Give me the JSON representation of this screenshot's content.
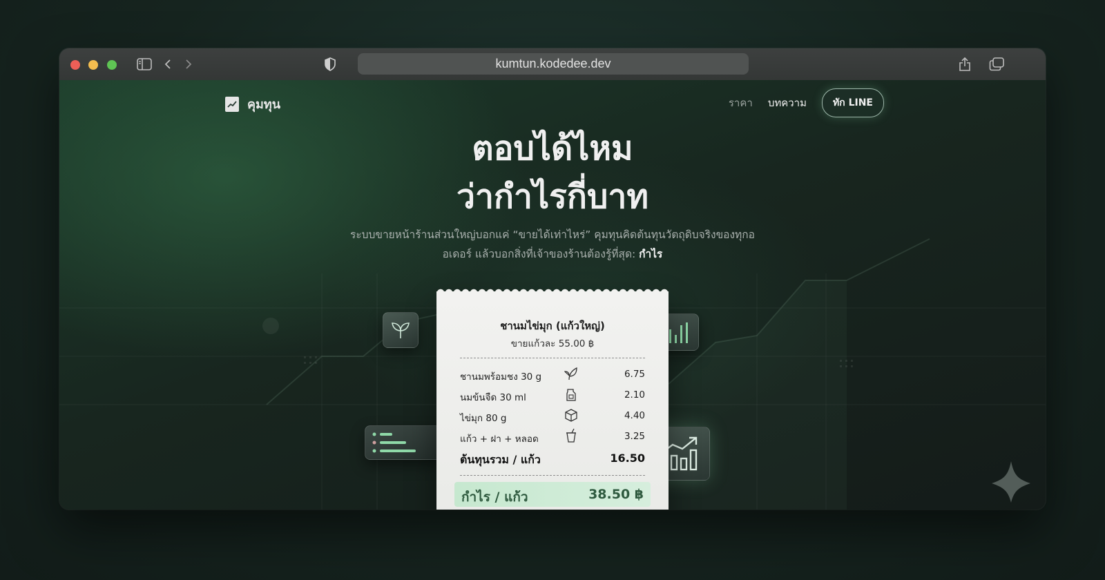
{
  "browser": {
    "url": "kumtun.kodedee.dev",
    "icons": [
      "sidebar-icon",
      "back-icon",
      "forward-icon",
      "shield-icon",
      "share-icon",
      "tabs-icon"
    ]
  },
  "site": {
    "brand_name": "คุมทุน",
    "nav": {
      "pricing": "ราคา",
      "articles": "บทความ",
      "cta": "ทัก LINE"
    }
  },
  "hero": {
    "title_line1": "ตอบได้ไหม",
    "title_line2": "ว่ากำไรกี่บาท",
    "subtitle_part1": "ระบบขายหน้าร้านส่วนใหญ่บอกแค่ “ขายได้เท่าไหร่” คุมทุนคิดต้นทุนวัตถุดิบจริงของทุกออเดอร์ แล้วบอกสิ่งที่เจ้าของร้านต้องรู้ที่สุด:",
    "subtitle_bold": "กำไร"
  },
  "receipt": {
    "title": "ชานมไข่มุก (แก้วใหญ่)",
    "price_line": "ขายแก้วละ 55.00 ฿",
    "items": [
      {
        "label": "ชานมพร้อมชง 30 g",
        "value": "6.75",
        "icon": "leaf-icon"
      },
      {
        "label": "นมข้นจืด 30 ml",
        "value": "2.10",
        "icon": "milk-jug-icon"
      },
      {
        "label": "ไข่มุก 80 g",
        "value": "4.40",
        "icon": "box-icon"
      },
      {
        "label": "แก้ว + ฝา + หลอด",
        "value": "3.25",
        "icon": "cup-icon"
      }
    ],
    "total_label": "ต้นทุนรวม / แก้ว",
    "total_value": "16.50",
    "profit_label": "กำไร / แก้ว",
    "profit_value": "38.50 ฿"
  },
  "colors": {
    "accent": "#8fd9a8",
    "profit_bg": "#c6e8cf",
    "profit_text": "#2f5a3f"
  }
}
